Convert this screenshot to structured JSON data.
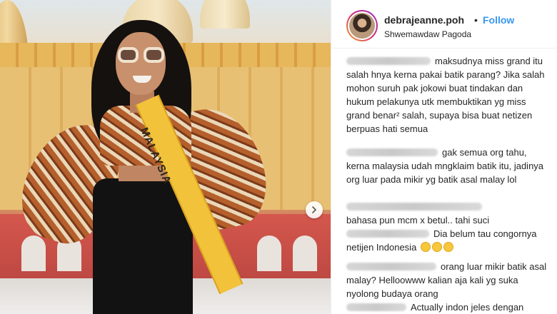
{
  "post": {
    "username": "debrajeanne.poh",
    "separator": "•",
    "follow_label": "Follow",
    "location": "Shwemawdaw Pagoda",
    "sash_text": "MALAYSIA"
  },
  "comments": [
    {
      "text_after": "maksudnya miss",
      "text": "grand itu salah hnya kerna pakai batik parang? Jika salah mohon suruh pak jokowi buat tindakan dan hukum pelakunya utk membuktikan yg miss grand benar² salah, supaya bisa buat netizen berpuas hati semua"
    },
    {
      "text_after": "gak semua org",
      "text": "tahu, kerna malaysia udah mngklaim batik itu, jadinya org luar pada mikir yg batik asal malay lol"
    },
    {
      "text_after": "",
      "text": "bahasa pun mcm x betul.. tahi suci"
    },
    {
      "text_after": "Dia belum tau congornya",
      "text": "netijen Indonesia"
    },
    {
      "text_after": "orang luar mikir",
      "text": "batik asal malay? Helloowww kalian aja kali yg suka nyolong budaya orang"
    },
    {
      "text_after": "Actually indon jeles dengan",
      "text": ""
    }
  ],
  "icons": {
    "next": "chevron-right-icon",
    "emoji": "laughing-emoji-icon"
  },
  "colors": {
    "follow": "#3897f0",
    "text": "#262626",
    "sash": "#f3c23b"
  }
}
